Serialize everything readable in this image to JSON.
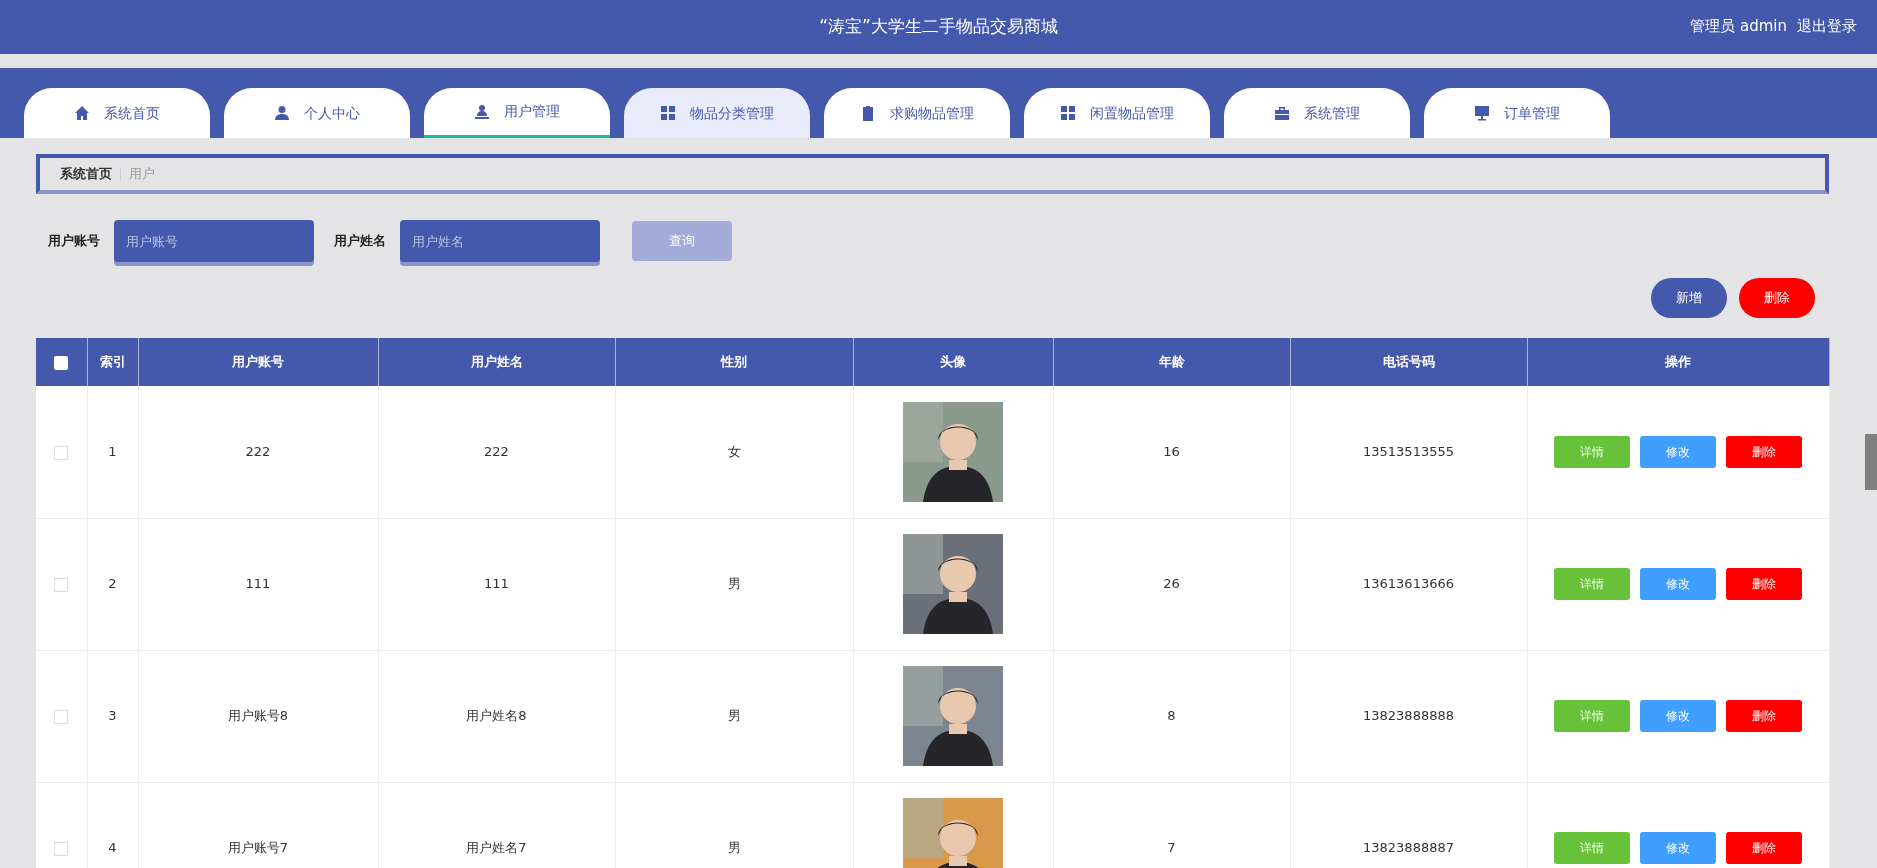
{
  "header": {
    "title": "“涛宝”大学生二手物品交易商城",
    "user": "管理员 admin",
    "logout": "退出登录"
  },
  "tabs": [
    {
      "label": "系统首页",
      "selected": false,
      "hovered": false
    },
    {
      "label": "个人中心",
      "selected": false,
      "hovered": false
    },
    {
      "label": "用户管理",
      "selected": true,
      "hovered": false
    },
    {
      "label": "物品分类管理",
      "selected": false,
      "hovered": true
    },
    {
      "label": "求购物品管理",
      "selected": false,
      "hovered": false
    },
    {
      "label": "闲置物品管理",
      "selected": false,
      "hovered": false
    },
    {
      "label": "系统管理",
      "selected": false,
      "hovered": false
    },
    {
      "label": "订单管理",
      "selected": false,
      "hovered": false
    }
  ],
  "breadcrumb": [
    "系统首页",
    "用户"
  ],
  "search": {
    "fields": [
      {
        "label": "用户账号",
        "placeholder": "用户账号"
      },
      {
        "label": "用户姓名",
        "placeholder": "用户姓名"
      }
    ],
    "button": "查询",
    "button_disabled": true
  },
  "toolbar": [
    {
      "label": "新增",
      "kind": "add"
    },
    {
      "label": "删除",
      "kind": "delete"
    }
  ],
  "table": {
    "select_all": false,
    "columns": [
      "索引",
      "用户账号",
      "用户姓名",
      "性别",
      "头像",
      "年龄",
      "电话号码",
      "操作"
    ],
    "rows": [
      {
        "checked": false,
        "cells": [
          "1",
          "222",
          "222",
          "女",
          {
            "kind": "picture"
          },
          "16",
          "13513513555"
        ],
        "actions": [
          {
            "label": "详情",
            "kind": "detail"
          },
          {
            "label": "修改",
            "kind": "edit"
          },
          {
            "label": "删除",
            "kind": "delete"
          }
        ]
      },
      {
        "checked": false,
        "cells": [
          "2",
          "111",
          "111",
          "男",
          {
            "kind": "picture"
          },
          "26",
          "13613613666"
        ],
        "actions": [
          {
            "label": "详情",
            "kind": "detail"
          },
          {
            "label": "修改",
            "kind": "edit"
          },
          {
            "label": "删除",
            "kind": "delete"
          }
        ]
      },
      {
        "checked": false,
        "cells": [
          "3",
          "用户账号8",
          "用户姓名8",
          "男",
          {
            "kind": "picture"
          },
          "8",
          "13823888888"
        ],
        "actions": [
          {
            "label": "详情",
            "kind": "detail"
          },
          {
            "label": "修改",
            "kind": "edit"
          },
          {
            "label": "删除",
            "kind": "delete"
          }
        ]
      },
      {
        "checked": false,
        "cells": [
          "4",
          "用户账号7",
          "用户姓名7",
          "男",
          {
            "kind": "picture"
          },
          "7",
          "13823888887"
        ],
        "actions": [
          {
            "label": "详情",
            "kind": "detail"
          },
          {
            "label": "修改",
            "kind": "edit"
          },
          {
            "label": "删除",
            "kind": "delete"
          }
        ]
      }
    ]
  }
}
